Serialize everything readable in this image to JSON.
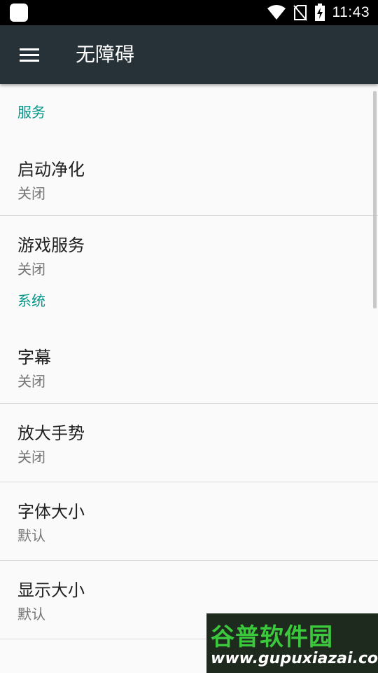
{
  "status_bar": {
    "time": "11:43",
    "icons": [
      "wifi-icon",
      "no-sim-icon",
      "battery-charging-icon"
    ]
  },
  "toolbar": {
    "menu_icon": "menu-icon",
    "title": "无障碍"
  },
  "sections": [
    {
      "header": "服务",
      "items": [
        {
          "title": "启动净化",
          "summary": "关闭"
        },
        {
          "title": "游戏服务",
          "summary": "关闭"
        }
      ]
    },
    {
      "header": "系统",
      "items": [
        {
          "title": "字幕",
          "summary": "关闭"
        },
        {
          "title": "放大手势",
          "summary": "关闭"
        },
        {
          "title": "字体大小",
          "summary": "默认"
        },
        {
          "title": "显示大小",
          "summary": "默认"
        }
      ]
    }
  ],
  "watermark": {
    "brand": "谷普软件园",
    "url": "www.gupuxiazai.com"
  },
  "colors": {
    "toolbar": "#263238",
    "accent": "#009688",
    "background": "#fafafa"
  }
}
